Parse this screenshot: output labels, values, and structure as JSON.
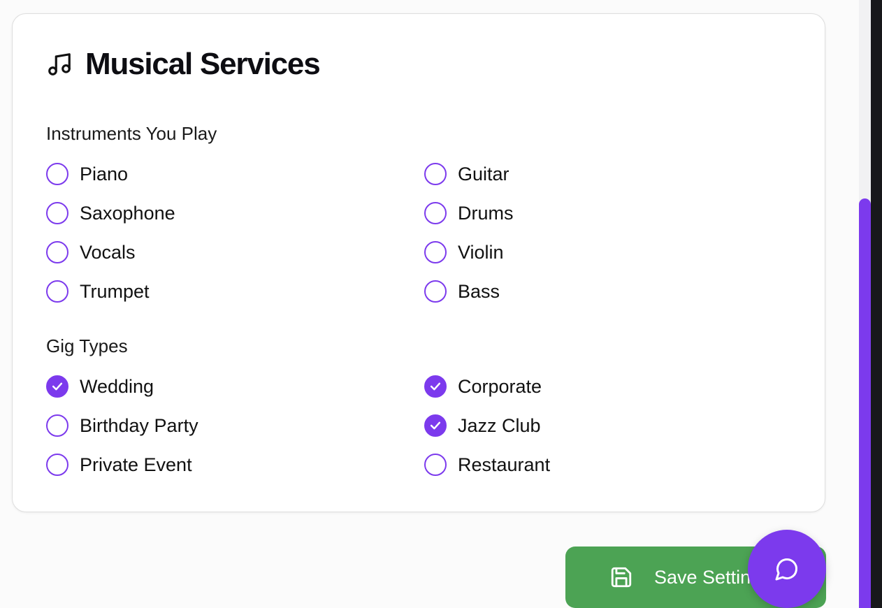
{
  "card": {
    "title": "Musical Services",
    "title_icon": "music-note-icon"
  },
  "instruments": {
    "label": "Instruments You Play",
    "options": [
      {
        "label": "Piano",
        "checked": false
      },
      {
        "label": "Guitar",
        "checked": false
      },
      {
        "label": "Saxophone",
        "checked": false
      },
      {
        "label": "Drums",
        "checked": false
      },
      {
        "label": "Vocals",
        "checked": false
      },
      {
        "label": "Violin",
        "checked": false
      },
      {
        "label": "Trumpet",
        "checked": false
      },
      {
        "label": "Bass",
        "checked": false
      }
    ]
  },
  "gig_types": {
    "label": "Gig Types",
    "options": [
      {
        "label": "Wedding",
        "checked": true
      },
      {
        "label": "Corporate",
        "checked": true
      },
      {
        "label": "Birthday Party",
        "checked": false
      },
      {
        "label": "Jazz Club",
        "checked": true
      },
      {
        "label": "Private Event",
        "checked": false
      },
      {
        "label": "Restaurant",
        "checked": false
      }
    ]
  },
  "save_button": {
    "label": "Save Settings",
    "icon": "save-icon"
  },
  "chat_fab": {
    "icon": "chat-bubble-icon"
  },
  "colors": {
    "accent": "#7c3aed",
    "save": "#4ca354"
  }
}
